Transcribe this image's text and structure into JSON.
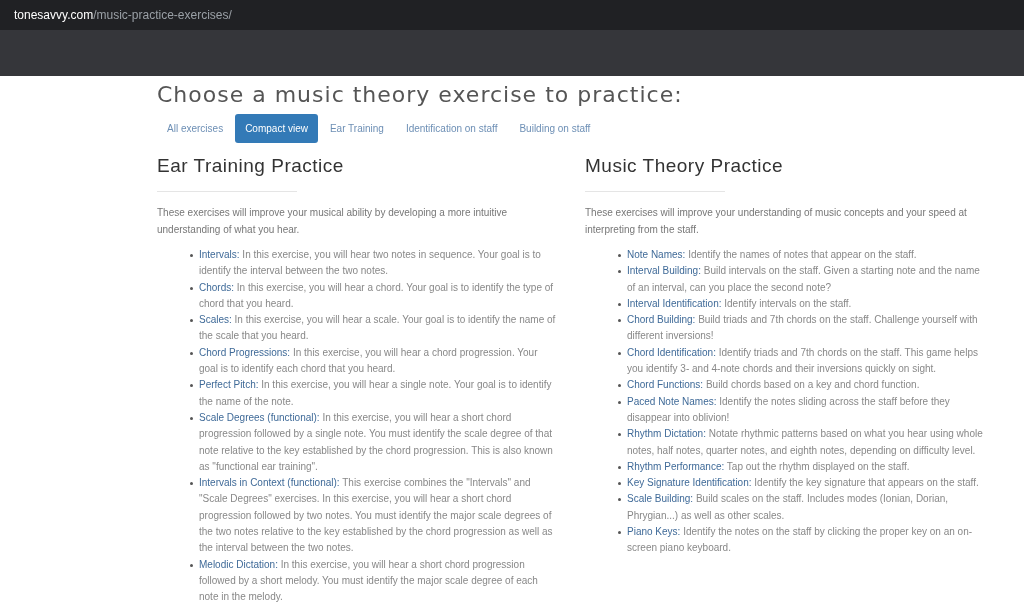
{
  "address_bar": {
    "domain": "tonesavvy.com",
    "path": "/music-practice-exercises/"
  },
  "page_title": "Choose a music theory exercise to practice:",
  "tabs": [
    {
      "label": "All exercises",
      "selected": false
    },
    {
      "label": "Compact view",
      "selected": true
    },
    {
      "label": "Ear Training",
      "selected": false
    },
    {
      "label": "Identification on staff",
      "selected": false
    },
    {
      "label": "Building on staff",
      "selected": false
    }
  ],
  "sections": [
    {
      "title": "Ear Training Practice",
      "intro": "These exercises will improve your musical ability by developing a more intuitive understanding of what you hear.",
      "items": [
        {
          "name": "Intervals:",
          "description": "In this exercise, you will hear two notes in sequence. Your goal is to identify the interval between the two notes."
        },
        {
          "name": "Chords:",
          "description": "In this exercise, you will hear a chord. Your goal is to identify the type of chord that you heard."
        },
        {
          "name": "Scales:",
          "description": "In this exercise, you will hear a scale. Your goal is to identify the name of the scale that you heard."
        },
        {
          "name": "Chord Progressions:",
          "description": "In this exercise, you will hear a chord progression. Your goal is to identify each chord that you heard."
        },
        {
          "name": "Perfect Pitch:",
          "description": "In this exercise, you will hear a single note. Your goal is to identify the name of the note."
        },
        {
          "name": "Scale Degrees (functional):",
          "description": "In this exercise, you will hear a short chord progression followed by a single note. You must identify the scale degree of that note relative to the key established by the chord progression. This is also known as \"functional ear training\"."
        },
        {
          "name": "Intervals in Context (functional):",
          "description": "This exercise combines the \"Intervals\" and \"Scale Degrees\" exercises. In this exercise, you will hear a short chord progression followed by two notes. You must identify the major scale degrees of the two notes relative to the key established by the chord progression as well as the interval between the two notes."
        },
        {
          "name": "Melodic Dictation:",
          "description": "In this exercise, you will hear a short chord progression followed by a short melody. You must identify the major scale degree of each note in the melody."
        }
      ]
    },
    {
      "title": "Music Theory Practice",
      "intro": "These exercises will improve your understanding of music concepts and your speed at interpreting from the staff.",
      "items": [
        {
          "name": "Note Names:",
          "description": "Identify the names of notes that appear on the staff."
        },
        {
          "name": "Interval Building:",
          "description": "Build intervals on the staff. Given a starting note and the name of an interval, can you place the second note?"
        },
        {
          "name": "Interval Identification:",
          "description": "Identify intervals on the staff."
        },
        {
          "name": "Chord Building:",
          "description": "Build triads and 7th chords on the staff. Challenge yourself with different inversions!"
        },
        {
          "name": "Chord Identification:",
          "description": "Identify triads and 7th chords on the staff. This game helps you identify 3- and 4-note chords and their inversions quickly on sight."
        },
        {
          "name": "Chord Functions:",
          "description": "Build chords based on a key and chord function."
        },
        {
          "name": "Paced Note Names:",
          "description": "Identify the notes sliding across the staff before they disappear into oblivion!"
        },
        {
          "name": "Rhythm Dictation:",
          "description": "Notate rhythmic patterns based on what you hear using whole notes, half notes, quarter notes, and eighth notes, depending on difficulty level."
        },
        {
          "name": "Rhythm Performance:",
          "description": "Tap out the rhythm displayed on the staff."
        },
        {
          "name": "Key Signature Identification:",
          "description": "Identify the key signature that appears on the staff."
        },
        {
          "name": "Scale Building:",
          "description": "Build scales on the staff. Includes modes (Ionian, Dorian, Phrygian...) as well as other scales."
        },
        {
          "name": "Piano Keys:",
          "description": "Identify the notes on the staff by clicking the proper key on an on-screen piano keyboard."
        }
      ]
    }
  ]
}
